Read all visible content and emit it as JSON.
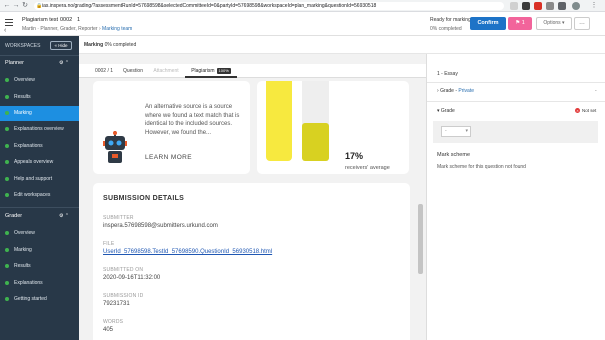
{
  "browser": {
    "url": "ias.inspera.no/grading/?assessmentRunId=57698598&selectedCommitteeId=0&partyId=57698598&workspaceId=plan_marking&questionId=56930518"
  },
  "header": {
    "test_title": "Plagiarism test",
    "test_number": "0002",
    "page_index": "1",
    "breadcrumb_people": "Martin · Planner, Grader, Reporter",
    "breadcrumb_link": "Marking team",
    "ready_label": "Ready for marking",
    "completed_label": "0% completed",
    "confirm_label": "Confirm",
    "flag_label": "1",
    "options_label": "Options",
    "more_label": "…",
    "flag_color": "#f2649b",
    "confirm_color": "#1d73c7"
  },
  "sidebar": {
    "workspaces_label": "WORKSPACES",
    "hide_label": "Hide",
    "planner_label": "Planner",
    "planner_items": [
      {
        "label": "Overview"
      },
      {
        "label": "Results"
      },
      {
        "label": "Marking"
      },
      {
        "label": "Explanations overview"
      },
      {
        "label": "Explanations"
      },
      {
        "label": "Appeals overview"
      },
      {
        "label": "Help and support"
      },
      {
        "label": "Edit workspaces"
      }
    ],
    "grader_label": "Grader",
    "grader_items": [
      {
        "label": "Overview"
      },
      {
        "label": "Marking"
      },
      {
        "label": "Results"
      },
      {
        "label": "Explanations"
      },
      {
        "label": "Getting started"
      }
    ],
    "active_color": "#1d8fe1",
    "bg_color": "#283848"
  },
  "main": {
    "marking_label": "Marking",
    "marking_progress": "0% completed",
    "tabs": [
      {
        "label": "0002 / 1"
      },
      {
        "label": "Question"
      },
      {
        "label": "Attachment"
      },
      {
        "label": "Plagiarism",
        "badge": "100%"
      }
    ],
    "alt_source_text": "An alternative source is a source where we found a text match that is identical to the included sources. However, we found the...",
    "learn_more": "LEARN MORE",
    "percent": "17%",
    "percent_label": "receivers' average",
    "submission": {
      "title": "SUBMISSION DETAILS",
      "submitter_label": "SUBMITTER",
      "submitter_value": "inspera.57698598@submitters.urkund.com",
      "file_label": "FILE",
      "file_value": "UserId_57698598.TestId_57698590.QuestionId_56930518.html",
      "submitted_label": "SUBMITTED ON",
      "submitted_value": "2020-09-16T11:32:00",
      "id_label": "SUBMISSION ID",
      "id_value": "79231731",
      "words_label": "WORDS",
      "words_value": "405"
    }
  },
  "right_panel": {
    "question_title": "1 - Essay",
    "grade_label": "Grade",
    "grade_private": "Private",
    "grade_dash": "-",
    "grade_section": "Grade",
    "not_set": "Not set",
    "select_placeholder": "-",
    "mark_scheme_title": "Mark scheme",
    "mark_scheme_text": "Mark scheme for this question not found"
  }
}
